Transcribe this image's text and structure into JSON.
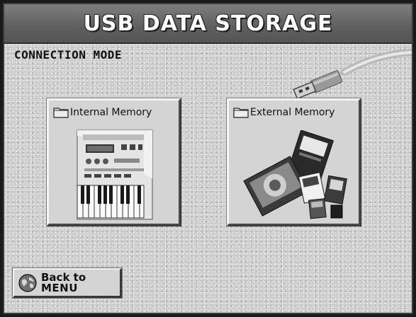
{
  "header": {
    "title": "USB DATA STORAGE"
  },
  "section": {
    "label": "CONNECTION MODE"
  },
  "options": {
    "internal": {
      "label": "Internal Memory"
    },
    "external": {
      "label": "External Memory"
    }
  },
  "footer": {
    "back_line1": "Back to",
    "back_line2": "MENU"
  },
  "icons": {
    "usb": "usb-cable-icon",
    "folder": "folder-icon",
    "globe": "globe-icon"
  },
  "colors": {
    "title_bar": "#6b6b6b",
    "panel": "#c9c9c9",
    "button_face": "#d4d4d4"
  }
}
